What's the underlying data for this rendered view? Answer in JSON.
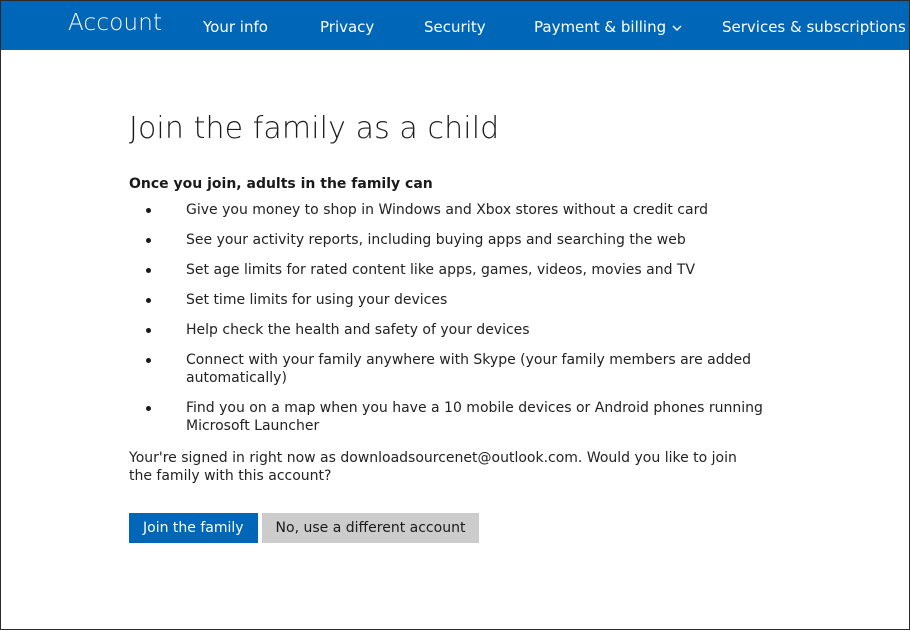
{
  "header": {
    "brand": "Account",
    "nav": [
      {
        "label": "Your info"
      },
      {
        "label": "Privacy"
      },
      {
        "label": "Security"
      },
      {
        "label": "Payment & billing"
      },
      {
        "label": "Services & subscriptions"
      }
    ]
  },
  "main": {
    "title": "Join the family as a child",
    "lead": "Once you join, adults in the family can",
    "items": [
      "Give you money to shop in Windows and Xbox stores without a credit card",
      "See your activity reports, including buying apps and searching the web",
      "Set age limits for rated content like apps, games, videos, movies and TV",
      "Set time limits for using your devices",
      "Help check the health and safety of your devices",
      "Connect with your family anywhere with Skype (your family members are added automatically)",
      "Find you on a map when you have a 10 mobile devices or Android phones running Microsoft Launcher"
    ],
    "signed_in_text": "Your're signed in right now as downloadsourcenet@outlook.com. Would you like to join the family with this account?",
    "join_button": "Join the family",
    "other_button": "No, use a different account"
  },
  "colors": {
    "brand_blue": "#0067b8",
    "secondary_button": "#cccccc"
  }
}
